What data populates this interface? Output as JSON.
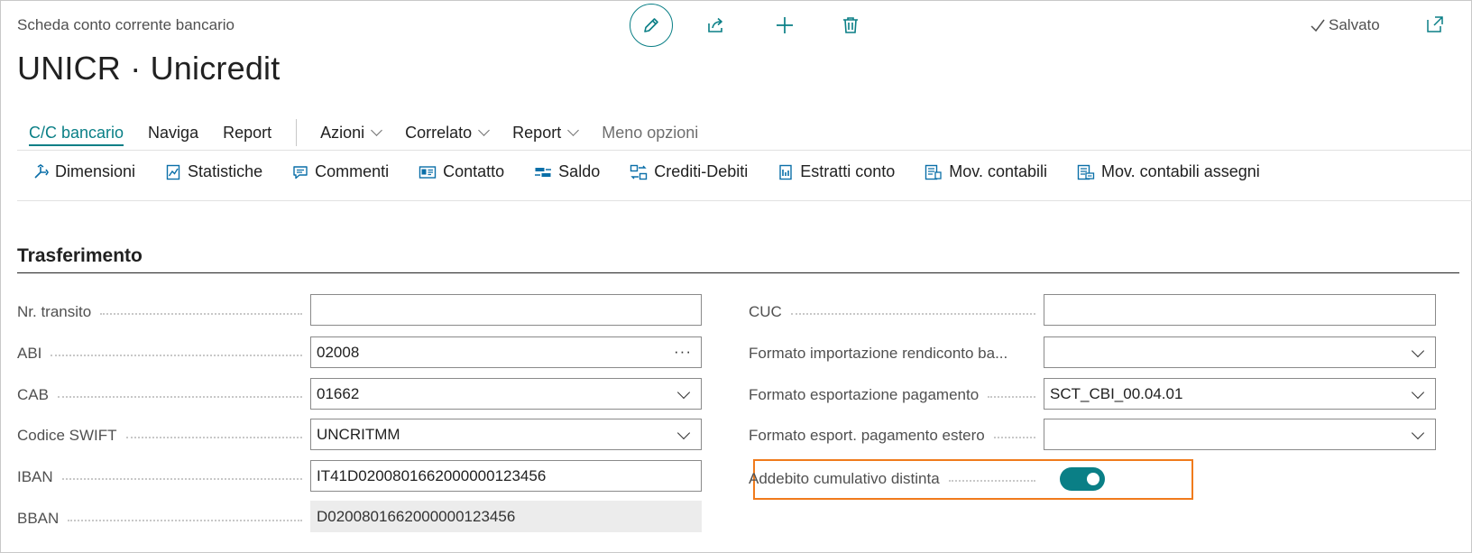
{
  "header": {
    "caption": "Scheda conto corrente bancario",
    "title": "UNICR · Unicredit",
    "saved_label": "Salvato"
  },
  "tabs": [
    {
      "label": "C/C bancario",
      "active": true
    },
    {
      "label": "Naviga"
    },
    {
      "label": "Report"
    },
    {
      "label": "Azioni",
      "dropdown": true
    },
    {
      "label": "Correlato",
      "dropdown": true
    },
    {
      "label": "Report",
      "dropdown": true
    },
    {
      "label": "Meno opzioni"
    }
  ],
  "actions": [
    {
      "label": "Dimensioni",
      "icon": "dimensions-icon"
    },
    {
      "label": "Statistiche",
      "icon": "statistics-icon"
    },
    {
      "label": "Commenti",
      "icon": "comments-icon"
    },
    {
      "label": "Contatto",
      "icon": "contact-icon"
    },
    {
      "label": "Saldo",
      "icon": "balance-icon"
    },
    {
      "label": "Crediti-Debiti",
      "icon": "receivables-payables-icon"
    },
    {
      "label": "Estratti conto",
      "icon": "statements-icon"
    },
    {
      "label": "Mov. contabili",
      "icon": "ledger-entries-icon"
    },
    {
      "label": "Mov. contabili assegni",
      "icon": "check-ledger-entries-icon"
    }
  ],
  "section": {
    "title": "Trasferimento"
  },
  "left_fields": [
    {
      "label": "Nr. transito",
      "value": "",
      "kind": "text"
    },
    {
      "label": "ABI",
      "value": "02008",
      "kind": "lookup"
    },
    {
      "label": "CAB",
      "value": "01662",
      "kind": "dropdown"
    },
    {
      "label": "Codice SWIFT",
      "value": "UNCRITMM",
      "kind": "dropdown"
    },
    {
      "label": "IBAN",
      "value": "IT41D0200801662000000123456",
      "kind": "text"
    },
    {
      "label": "BBAN",
      "value": "D0200801662000000123456",
      "kind": "readonly"
    }
  ],
  "right_fields": [
    {
      "label": "CUC",
      "value": "",
      "kind": "text"
    },
    {
      "label": "Formato importazione rendiconto ba...",
      "value": "",
      "kind": "dropdown"
    },
    {
      "label": "Formato esportazione pagamento",
      "value": "SCT_CBI_00.04.01",
      "kind": "dropdown"
    },
    {
      "label": "Formato esport. pagamento estero",
      "value": "",
      "kind": "dropdown"
    },
    {
      "label": "Addebito cumulativo distinta",
      "value": "on",
      "kind": "toggle"
    }
  ],
  "colors": {
    "accent": "#0a7f86",
    "highlight": "#f07b1c"
  }
}
